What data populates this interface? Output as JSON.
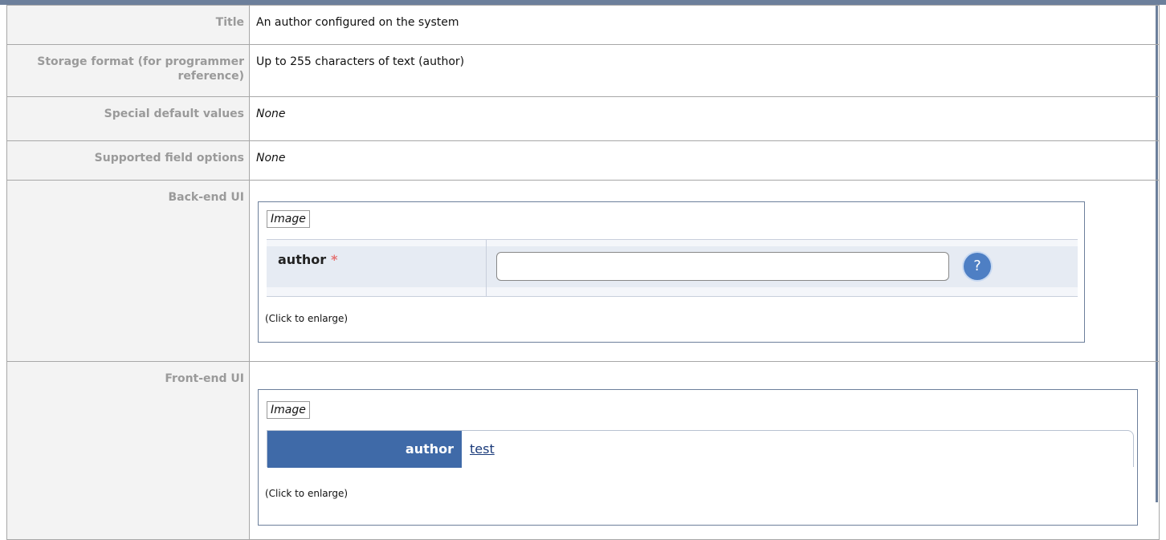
{
  "rows": {
    "title": {
      "label": "Title",
      "value": "An author configured on the system"
    },
    "storage": {
      "label": "Storage format (for programmer reference)",
      "value": "Up to 255 characters of text (author)"
    },
    "special": {
      "label": "Special default values",
      "value": "None"
    },
    "options": {
      "label": "Supported field options",
      "value": "None"
    },
    "backend": {
      "label": "Back-end UI",
      "image_caption": "Image",
      "field_label": "author",
      "required_mark": "*",
      "help_glyph": "?",
      "enlarge": "(Click to enlarge)"
    },
    "frontend": {
      "label": "Front-end UI",
      "image_caption": "Image",
      "field_label": "author",
      "field_value": "test",
      "enlarge": "(Click to enlarge)"
    }
  },
  "colors": {
    "frame": "#6c7f9b",
    "header_bg": "#f3f3f3",
    "label_text": "#9a9a9a",
    "frontend_label_bg": "#3f6aa8",
    "help_button": "#4e7fc4"
  }
}
